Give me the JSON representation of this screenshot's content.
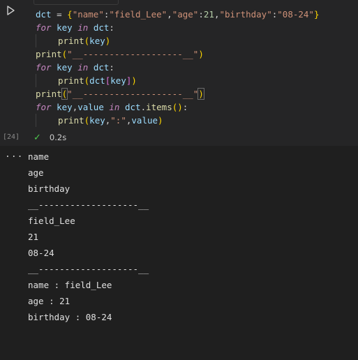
{
  "cell": {
    "execution_count": "[24]",
    "status_time": "0.2s",
    "run_icon": "play-icon",
    "status_icon": "check-icon",
    "more_icon": "ellipsis-icon",
    "more_label": "..."
  },
  "code_lines": [
    "dct = {\"name\":\"field_Lee\",\"age\":21,\"birthday\":\"08-24\"}",
    "for key in dct:",
    "    print(key)",
    "print(\"__-------------------__\")",
    "for key in dct:",
    "    print(dct[key])",
    "print(\"__-------------------__\")",
    "for key,value in dct.items():",
    "    print(key,\":\",value)"
  ],
  "code_tokens": {
    "l1": [
      "dct",
      " = ",
      "{",
      "\"name\"",
      ":",
      "\"field_Lee\"",
      ",",
      "\"age\"",
      ":",
      "21",
      ",",
      "\"birthday\"",
      ":",
      "\"08-24\"",
      "}"
    ],
    "l2": [
      "for",
      " ",
      "key",
      " ",
      "in",
      " ",
      "dct",
      ":"
    ],
    "l3": [
      "print",
      "(",
      "key",
      ")"
    ],
    "l4": [
      "print",
      "(",
      "\"__-------------------__\"",
      ")"
    ],
    "l5": [
      "for",
      " ",
      "key",
      " ",
      "in",
      " ",
      "dct",
      ":"
    ],
    "l6": [
      "print",
      "(",
      "dct",
      "[",
      "key",
      "]",
      ")"
    ],
    "l7": [
      "print",
      "(",
      "\"__-------------------__\"",
      ")"
    ],
    "l8": [
      "for",
      " ",
      "key",
      ",",
      "value",
      " ",
      "in",
      " ",
      "dct",
      ".",
      "items",
      "()",
      ":"
    ],
    "l9": [
      "print",
      "(",
      "key",
      ",",
      "\":\"",
      ",",
      "value",
      ")"
    ]
  },
  "output_lines": [
    "name",
    "age",
    "birthday",
    "__-------------------__",
    "field_Lee",
    "21",
    "08-24",
    "__-------------------__",
    "name : field_Lee",
    "age : 21",
    "birthday : 08-24"
  ]
}
